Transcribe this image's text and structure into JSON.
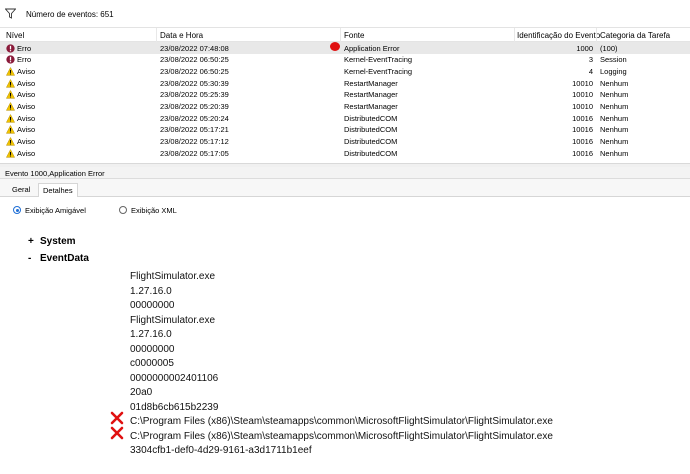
{
  "filter": {
    "icon": "funnel-icon",
    "text": "Número de eventos: 651"
  },
  "columns": {
    "nivel": "Nível",
    "data": "Data e Hora",
    "fonte": "Fonte",
    "id": "Identificação do Evento",
    "cat": "Categoria da Tarefa"
  },
  "rows": [
    {
      "level": "Erro",
      "date": "23/08/2022 07:48:08",
      "source": "Application Error",
      "id": "1000",
      "cat": "(100)",
      "type": "error"
    },
    {
      "level": "Erro",
      "date": "23/08/2022 06:50:25",
      "source": "Kernel-EventTracing",
      "id": "3",
      "cat": "Session",
      "type": "error"
    },
    {
      "level": "Aviso",
      "date": "23/08/2022 06:50:25",
      "source": "Kernel-EventTracing",
      "id": "4",
      "cat": "Logging",
      "type": "warning"
    },
    {
      "level": "Aviso",
      "date": "23/08/2022 05:30:39",
      "source": "RestartManager",
      "id": "10010",
      "cat": "Nenhum",
      "type": "warning"
    },
    {
      "level": "Aviso",
      "date": "23/08/2022 05:25:39",
      "source": "RestartManager",
      "id": "10010",
      "cat": "Nenhum",
      "type": "warning"
    },
    {
      "level": "Aviso",
      "date": "23/08/2022 05:20:39",
      "source": "RestartManager",
      "id": "10010",
      "cat": "Nenhum",
      "type": "warning"
    },
    {
      "level": "Aviso",
      "date": "23/08/2022 05:20:24",
      "source": "DistributedCOM",
      "id": "10016",
      "cat": "Nenhum",
      "type": "warning"
    },
    {
      "level": "Aviso",
      "date": "23/08/2022 05:17:21",
      "source": "DistributedCOM",
      "id": "10016",
      "cat": "Nenhum",
      "type": "warning"
    },
    {
      "level": "Aviso",
      "date": "23/08/2022 05:17:12",
      "source": "DistributedCOM",
      "id": "10016",
      "cat": "Nenhum",
      "type": "warning"
    },
    {
      "level": "Aviso",
      "date": "23/08/2022 05:17:05",
      "source": "DistributedCOM",
      "id": "10016",
      "cat": "Nenhum",
      "type": "warning"
    }
  ],
  "detail_title": "Evento 1000,Application Error",
  "tabs": {
    "geral": "Geral",
    "detalhes": "Detalhes"
  },
  "view": {
    "friendly": "Exibição Amigável",
    "xml": "Exibição XML"
  },
  "tree": {
    "system": {
      "sym": "+",
      "label": "System"
    },
    "eventdata": {
      "sym": "-",
      "label": "EventData"
    }
  },
  "event_values": [
    "FlightSimulator.exe",
    "1.27.16.0",
    "00000000",
    "FlightSimulator.exe",
    "1.27.16.0",
    "00000000",
    "c0000005",
    "0000000002401106",
    "20a0",
    "01d8b6cb615b2239",
    "C:\\Program Files (x86)\\Steam\\steamapps\\common\\MicrosoftFlightSimulator\\FlightSimulator.exe",
    "C:\\Program Files (x86)\\Steam\\steamapps\\common\\MicrosoftFlightSimulator\\FlightSimulator.exe",
    "3304cfb1-def0-4d29-9161-a3d1711b1eef"
  ],
  "colors": {
    "error": "#8a1a3a",
    "warning": "#f2c400",
    "annotation": "#e01010",
    "accent": "#1f6fd6"
  }
}
